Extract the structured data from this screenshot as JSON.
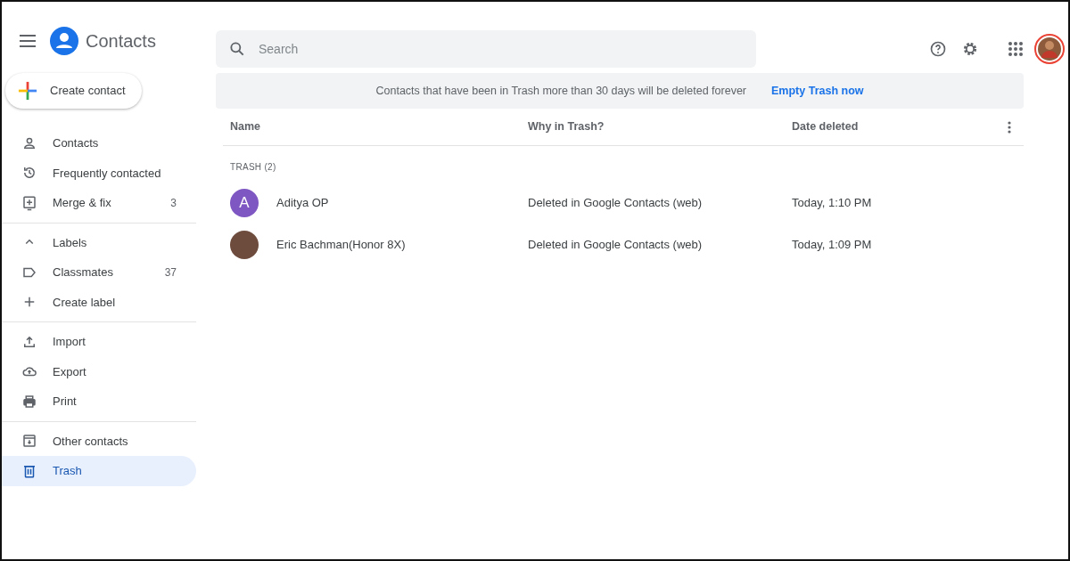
{
  "app": {
    "title": "Contacts"
  },
  "create_button": {
    "label": "Create contact"
  },
  "sidebar": {
    "sections": [
      {
        "items": [
          {
            "label": "Contacts",
            "selected": false
          },
          {
            "label": "Frequently contacted",
            "selected": false
          },
          {
            "label": "Merge & fix",
            "count": "3",
            "selected": false
          }
        ]
      },
      {
        "items": [
          {
            "label": "Labels",
            "kind": "header",
            "expanded": true
          },
          {
            "label": "Classmates",
            "count": "37",
            "selected": false
          },
          {
            "label": "Create label",
            "selected": false
          }
        ]
      },
      {
        "items": [
          {
            "label": "Import",
            "selected": false
          },
          {
            "label": "Export",
            "selected": false
          },
          {
            "label": "Print",
            "selected": false
          }
        ]
      },
      {
        "items": [
          {
            "label": "Other contacts",
            "selected": false
          },
          {
            "label": "Trash",
            "selected": true
          }
        ]
      }
    ]
  },
  "search": {
    "placeholder": "Search"
  },
  "banner": {
    "message": "Contacts that have been in Trash more than 30 days will be deleted forever",
    "action": "Empty Trash now"
  },
  "table": {
    "columns": [
      "Name",
      "Why in Trash?",
      "Date deleted"
    ],
    "group_label": "TRASH (2)",
    "rows": [
      {
        "avatar": {
          "kind": "letter",
          "initial": "A",
          "color": "#7e57c2"
        },
        "name": "Aditya OP",
        "reason": "Deleted in Google Contacts (web)",
        "date": "Today, 1:10 PM"
      },
      {
        "avatar": {
          "kind": "photo"
        },
        "name": "Eric Bachman(Honor 8X)",
        "reason": "Deleted in Google Contacts (web)",
        "date": "Today, 1:09 PM"
      }
    ]
  }
}
